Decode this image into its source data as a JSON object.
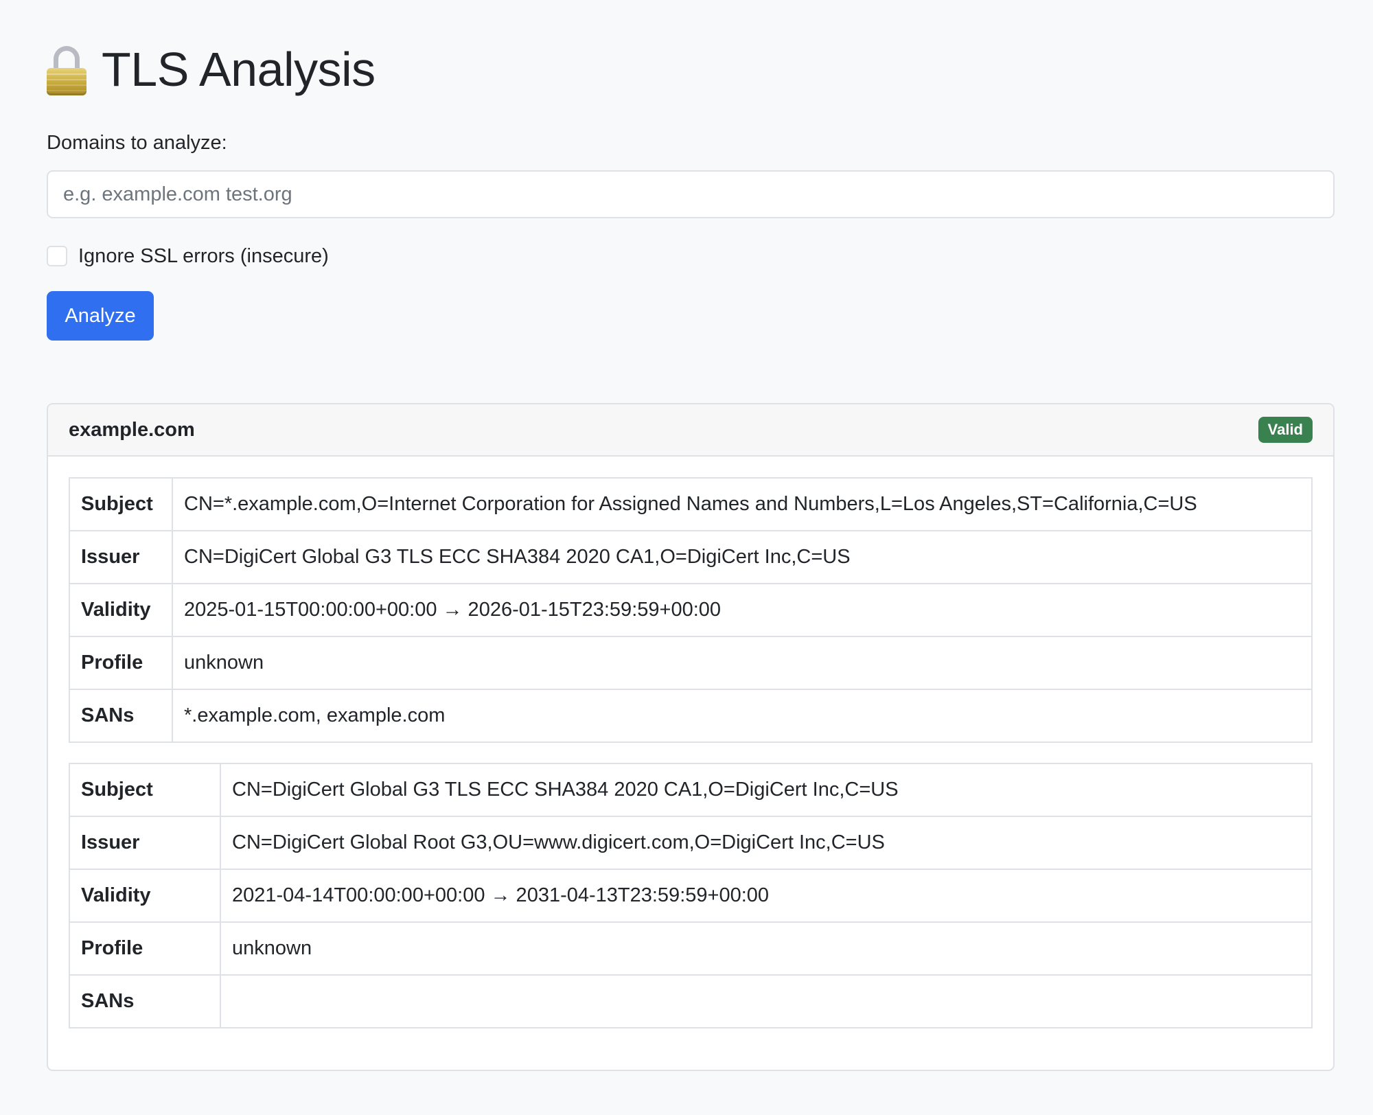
{
  "header": {
    "title": "TLS Analysis",
    "icon": "lock-icon"
  },
  "form": {
    "domains_label": "Domains to analyze:",
    "domains_placeholder": "e.g. example.com test.org",
    "domains_value": "",
    "ignore_ssl_label": "Ignore SSL errors (insecure)",
    "ignore_ssl_checked": false,
    "analyze_label": "Analyze"
  },
  "result": {
    "domain": "example.com",
    "status": "Valid",
    "status_color": "#3a8150",
    "certificates": [
      {
        "rows": [
          {
            "key": "Subject",
            "value": "CN=*.example.com,O=Internet Corporation for Assigned Names and Numbers,L=Los Angeles,ST=California,C=US"
          },
          {
            "key": "Issuer",
            "value": "CN=DigiCert Global G3 TLS ECC SHA384 2020 CA1,O=DigiCert Inc,C=US"
          },
          {
            "key": "Validity",
            "value": "2025-01-15T00:00:00+00:00 → 2026-01-15T23:59:59+00:00"
          },
          {
            "key": "Profile",
            "value": "unknown"
          },
          {
            "key": "SANs",
            "value": "*.example.com, example.com"
          }
        ]
      },
      {
        "rows": [
          {
            "key": "Subject",
            "value": "CN=DigiCert Global G3 TLS ECC SHA384 2020 CA1,O=DigiCert Inc,C=US"
          },
          {
            "key": "Issuer",
            "value": "CN=DigiCert Global Root G3,OU=www.digicert.com,O=DigiCert Inc,C=US"
          },
          {
            "key": "Validity",
            "value": "2021-04-14T00:00:00+00:00 → 2031-04-13T23:59:59+00:00"
          },
          {
            "key": "Profile",
            "value": "unknown"
          },
          {
            "key": "SANs",
            "value": ""
          }
        ]
      }
    ]
  },
  "colors": {
    "page_background": "#f8f9fa",
    "primary_button": "#2f6ff0",
    "border": "#dee2e6"
  }
}
